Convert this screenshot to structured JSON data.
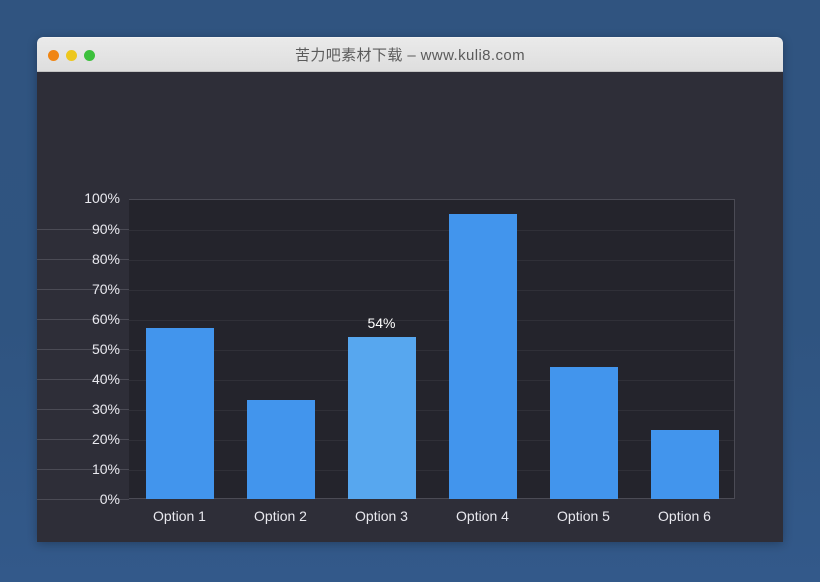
{
  "window": {
    "title": "苦力吧素材下载 – www.kuli8.com",
    "lights": [
      {
        "name": "close",
        "color": "#f08513"
      },
      {
        "name": "minimize",
        "color": "#edc71d"
      },
      {
        "name": "maximize",
        "color": "#3cc03c"
      }
    ]
  },
  "colors": {
    "desktop_bg": "#2f5480",
    "window_body_bg": "#2e2e38",
    "plot_bg": "#24242c",
    "titlebar_bg": "#e2e2e2",
    "bar": "#4295ed",
    "bar_highlight": "#57a7ef",
    "gridline": "#4b4b55",
    "text": "#e9e9ef"
  },
  "chart_data": {
    "type": "bar",
    "title": "",
    "xlabel": "",
    "ylabel": "",
    "categories": [
      "Option 1",
      "Option 2",
      "Option 3",
      "Option 4",
      "Option 5",
      "Option 6"
    ],
    "values": [
      57,
      33,
      54,
      95,
      44,
      23
    ],
    "value_labels": [
      "",
      "",
      "54%",
      "",
      "",
      ""
    ],
    "highlighted_index": 2,
    "ylim": [
      0,
      100
    ],
    "ytick_values": [
      100,
      90,
      80,
      70,
      60,
      50,
      40,
      30,
      20,
      10,
      0
    ],
    "ytick_labels": [
      "100%",
      "90%",
      "80%",
      "70%",
      "60%",
      "50%",
      "40%",
      "30%",
      "20%",
      "10%",
      "0%"
    ],
    "grid": true,
    "legend": "none"
  }
}
